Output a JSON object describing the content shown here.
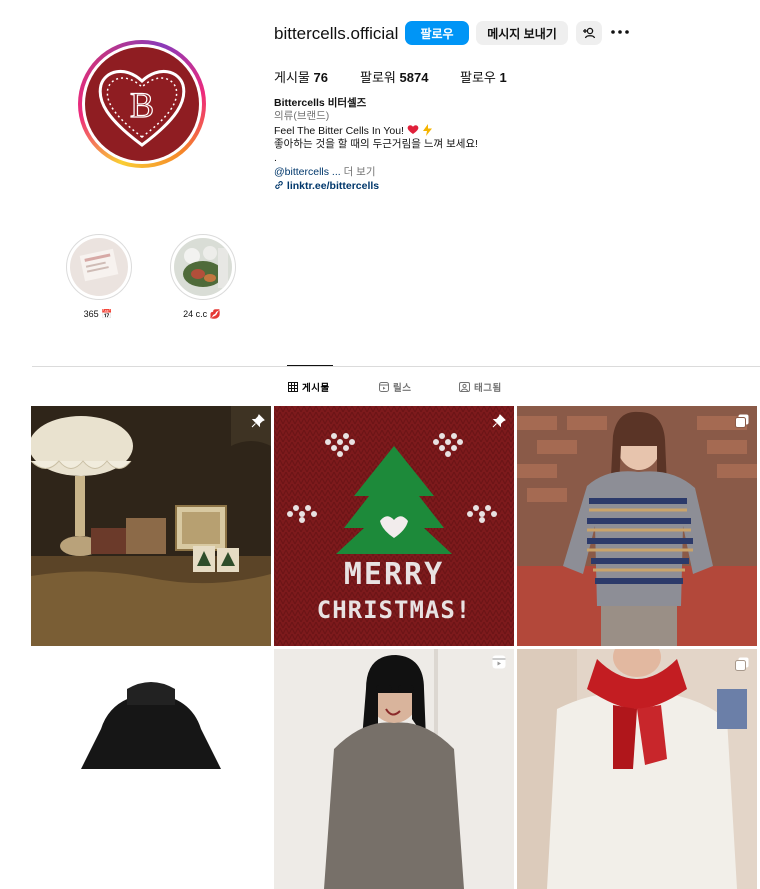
{
  "profile": {
    "username": "bittercells.official",
    "follow_label": "팔로우",
    "message_label": "메시지 보내기",
    "avatar_letter": "B"
  },
  "stats": {
    "posts_label": "게시물",
    "posts_count": "76",
    "followers_label": "팔로워",
    "followers_count": "5874",
    "following_label": "팔로우",
    "following_count": "1"
  },
  "bio": {
    "name": "Bittercells 비터셀즈",
    "category": "의류(브랜드)",
    "line1": "Feel The Bitter Cells In You!",
    "line2": "좋아하는 것을 할 때의 두근거림을 느껴 보세요!",
    "line3": ".",
    "mention": "@bittercells ...",
    "more": "더 보기",
    "link": "linktr.ee/bittercells"
  },
  "highlights": [
    {
      "label": "365 📅"
    },
    {
      "label": "24 c.c 💋"
    }
  ],
  "tabs": {
    "posts": "게시물",
    "reels": "릴스",
    "tagged": "태그됨"
  },
  "post_tiles": {
    "tile2_text_line1": "MERRY",
    "tile2_text_line2": "CHRISTMAS!"
  },
  "colors": {
    "accent": "#0095f6",
    "brand_red": "#8f1d22",
    "link": "#00376b"
  }
}
